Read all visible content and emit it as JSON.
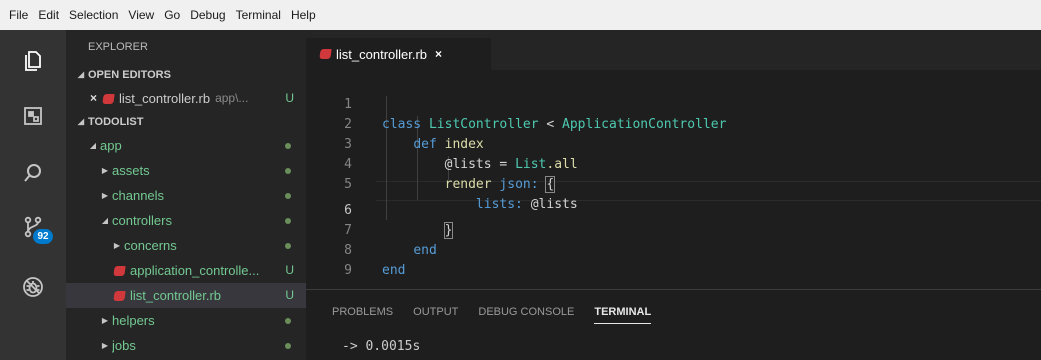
{
  "menubar": {
    "items": [
      "File",
      "Edit",
      "Selection",
      "View",
      "Go",
      "Debug",
      "Terminal",
      "Help"
    ]
  },
  "activitybar": {
    "icons": [
      "explorer-icon",
      "extensions-icon",
      "search-icon",
      "source-control-icon",
      "debug-icon"
    ],
    "source_control_badge": "92"
  },
  "sidebar": {
    "title": "EXPLORER",
    "open_editors": {
      "label": "OPEN EDITORS",
      "item": {
        "close": "×",
        "name": "list_controller.rb",
        "path": "app\\...",
        "status": "U"
      }
    },
    "project": {
      "label": "TODOLIST",
      "tree": [
        {
          "name": "app",
          "expanded": true
        },
        {
          "name": "assets",
          "expanded": false
        },
        {
          "name": "channels",
          "expanded": false
        },
        {
          "name": "controllers",
          "expanded": true
        },
        {
          "name": "concerns",
          "expanded": false
        },
        {
          "name": "application_controlle...",
          "status": "U"
        },
        {
          "name": "list_controller.rb",
          "status": "U",
          "selected": true
        },
        {
          "name": "helpers",
          "expanded": false
        },
        {
          "name": "jobs",
          "expanded": false
        }
      ]
    }
  },
  "editor": {
    "tab": {
      "name": "list_controller.rb",
      "close": "×"
    },
    "line_numbers": [
      "1",
      "2",
      "3",
      "4",
      "5",
      "6",
      "7",
      "8",
      "9"
    ],
    "active_line": "6",
    "code": {
      "l1_kw": "class",
      "l1_cls": "ListController",
      "l1_op": "<",
      "l1_parent": "ApplicationController",
      "l2_kw": "def",
      "l2_fn": "index",
      "l3_var": "@lists",
      "l3_op": "=",
      "l3_cls": "List",
      "l3_call": ".all",
      "l4_fn": "render",
      "l4_sym": "json:",
      "l4_brace": "{",
      "l5_key": "lists:",
      "l5_val": "@lists",
      "l6_brace": "}",
      "l7_kw": "end",
      "l8_kw": "end"
    }
  },
  "panel": {
    "tabs": [
      "PROBLEMS",
      "OUTPUT",
      "DEBUG CONSOLE",
      "TERMINAL"
    ],
    "active_tab": "TERMINAL",
    "terminal_line": "-> 0.0015s"
  },
  "colors": {
    "menubar_bg": "#f0f0f0",
    "activitybar_bg": "#333333",
    "sidebar_bg": "#252526",
    "editor_bg": "#1e1e1e",
    "badge_bg": "#007acc",
    "untracked_green": "#73c991",
    "ruby_red": "#d1383b"
  }
}
